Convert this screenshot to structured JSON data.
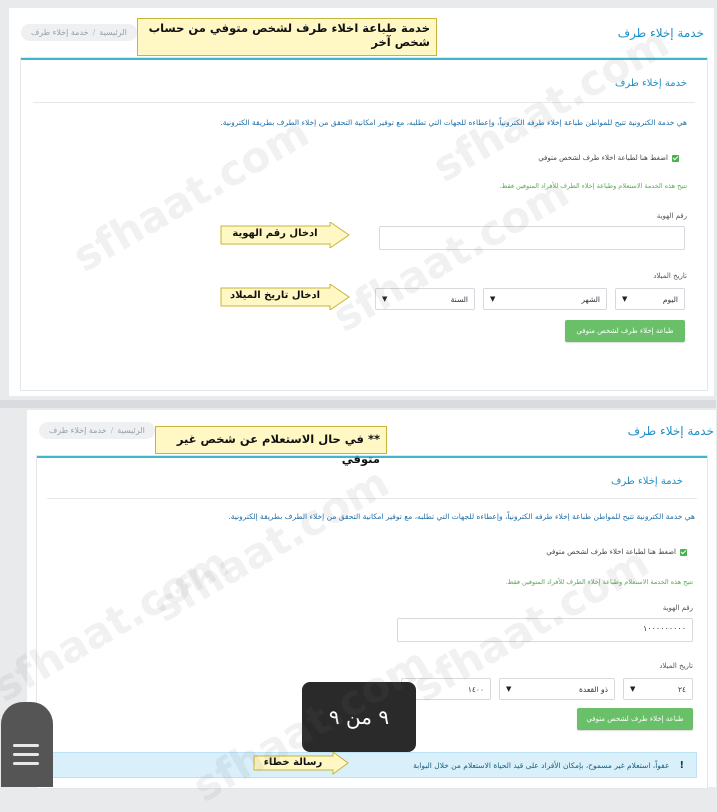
{
  "top": {
    "header_title": "خدمة إخلاء طرف",
    "breadcrumb": {
      "home": "الرئيسية",
      "current": "خدمة إخلاء طرف"
    },
    "callout": "خدمة طباعة اخلاء طرف لشخص متوفي من حساب شخص آخر",
    "card_title": "خدمة إخلاء طرف",
    "description": "هي خدمة الكترونية تتيح للمواطن طباعة إخلاء طرفه الكترونياً، وإعطاءه للجهات التي تطلبه، مع توفير امكانية التحقق من إخلاء الطرف بطريقة الكترونية.",
    "checkbox_label": "اضغط هنا لطباعة اخلاء طرف لشخص متوفي",
    "note": "تتيح هذه الخدمة الاستعلام وطباعة إخلاء الطرف للأفراد المتوفين فقط.",
    "id_label": "رقم الهوية",
    "id_value": "",
    "dob_label": "تاريخ الميلاد",
    "day": "اليوم",
    "month": "الشهر",
    "year": "السنة",
    "submit": "طباعة إخلاء طرف لشخص متوفي",
    "arrow_id": "ادخال رقم الهوية",
    "arrow_dob": "ادخال تاريخ الميلاد"
  },
  "bottom": {
    "header_title": "خدمة إخلاء طرف",
    "breadcrumb": {
      "home": "الرئيسية",
      "current": "خدمة إخلاء طرف"
    },
    "callout": "** في حال الاستعلام عن شخص غير متوفي",
    "card_title": "خدمة إخلاء طرف",
    "description": "هي خدمة الكترونية تتيح للمواطن طباعة إخلاء طرفه الكترونياً، وإعطاءه للجهات التي تطلبه، مع توفير امكانية التحقق من إخلاء الطرف بطريقة إلكترونية.",
    "checkbox_label": "اضغط هنا لطباعة اخلاء طرف لشخص متوفي",
    "note": "تتيح هذه الخدمة الاستعلام وطباعة إخلاء الطرف للأفراد المتوفين فقط.",
    "id_label": "رقم الهوية",
    "id_value": "١٠٠٠٠٠٠٠٠٠",
    "dob_label": "تاريخ الميلاد",
    "day": "٢٤",
    "month": "ذو القعدة",
    "year": "١٤٠٠",
    "submit": "طباعة إخلاء طرف لشخص متوفي",
    "error": "عفواً، استعلام غير مسموح، بإمكان الأفراد على قيد الحياة الاستعلام من خلال البوابة",
    "arrow_error": "رسالة خطاء"
  },
  "pager": "٩ من ٩",
  "watermark": "sfhaat.com",
  "colors": {
    "accent": "#1f8fc7",
    "button": "#6abf69",
    "callout_bg": "#fff8c4",
    "alert_bg": "#d9f0fb"
  }
}
